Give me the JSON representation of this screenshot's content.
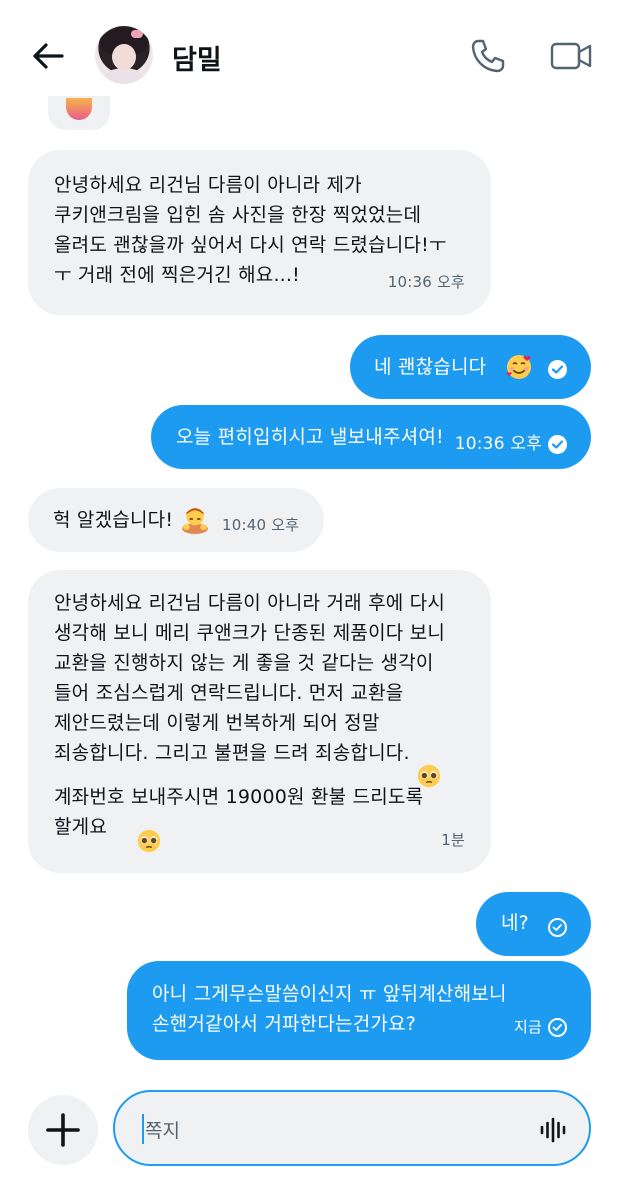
{
  "header": {
    "contact_name": "담밀",
    "back_icon": "arrow-left-icon",
    "call_icon": "phone-icon",
    "video_icon": "video-camera-icon"
  },
  "messages": [
    {
      "side": "in",
      "text": "안녕하세요 리건님 다름이 아니라 제가\n쿠키앤크림을 입힌 솜 사진을 한장 찍었었는데\n올려도 괜찮을까 싶어서 다시 연락 드렸습니다!ㅜ\nㅜ 거래 전에 찍은거긴 해요...!",
      "time": "10:36 오후"
    },
    {
      "side": "out",
      "text": "네 괜찮습니다",
      "emoji": "smiling-face-with-hearts",
      "time": "",
      "status": "read"
    },
    {
      "side": "out",
      "text": "오늘 편히입히시고 낼보내주셔여!",
      "time": "10:36 오후",
      "status": "read"
    },
    {
      "side": "in",
      "text": "헉 알겠습니다!",
      "emoji": "person-bowing",
      "time": "10:40 오후"
    },
    {
      "side": "in",
      "text": "안녕하세요 리건님 다름이 아니라 거래 후에 다시\n생각해 보니 메리 쿠앤크가 단종된 제품이다 보니\n교환을 진행하지 않는 게 좋을 것 같다는 생각이\n들어 조심스럽게 연락드립니다. 먼저 교환을\n제안드렸는데 이렇게 번복하게 되어 정말\n죄송합니다. 그리고 불편을 드려 죄송합니다.",
      "text2": "계좌번호 보내주시면 19000원 환불 드리도록\n할게요",
      "emoji": "pleading-face",
      "time": "1분"
    },
    {
      "side": "out",
      "text": "네?",
      "time": "",
      "status": "sent"
    },
    {
      "side": "out",
      "text": "아니 그게무슨말씀이신지 ㅠ 앞뒤계산해보니\n손핸거같아서 거파한다는건가요?",
      "time": "지금",
      "status": "sent"
    }
  ],
  "composer": {
    "placeholder": "쪽지",
    "add_icon": "plus-icon",
    "voice_icon": "voice-waveform-icon"
  },
  "colors": {
    "accent": "#1d9bf0",
    "incoming_bubble": "#eff1f3",
    "secondary_text": "#536471"
  }
}
